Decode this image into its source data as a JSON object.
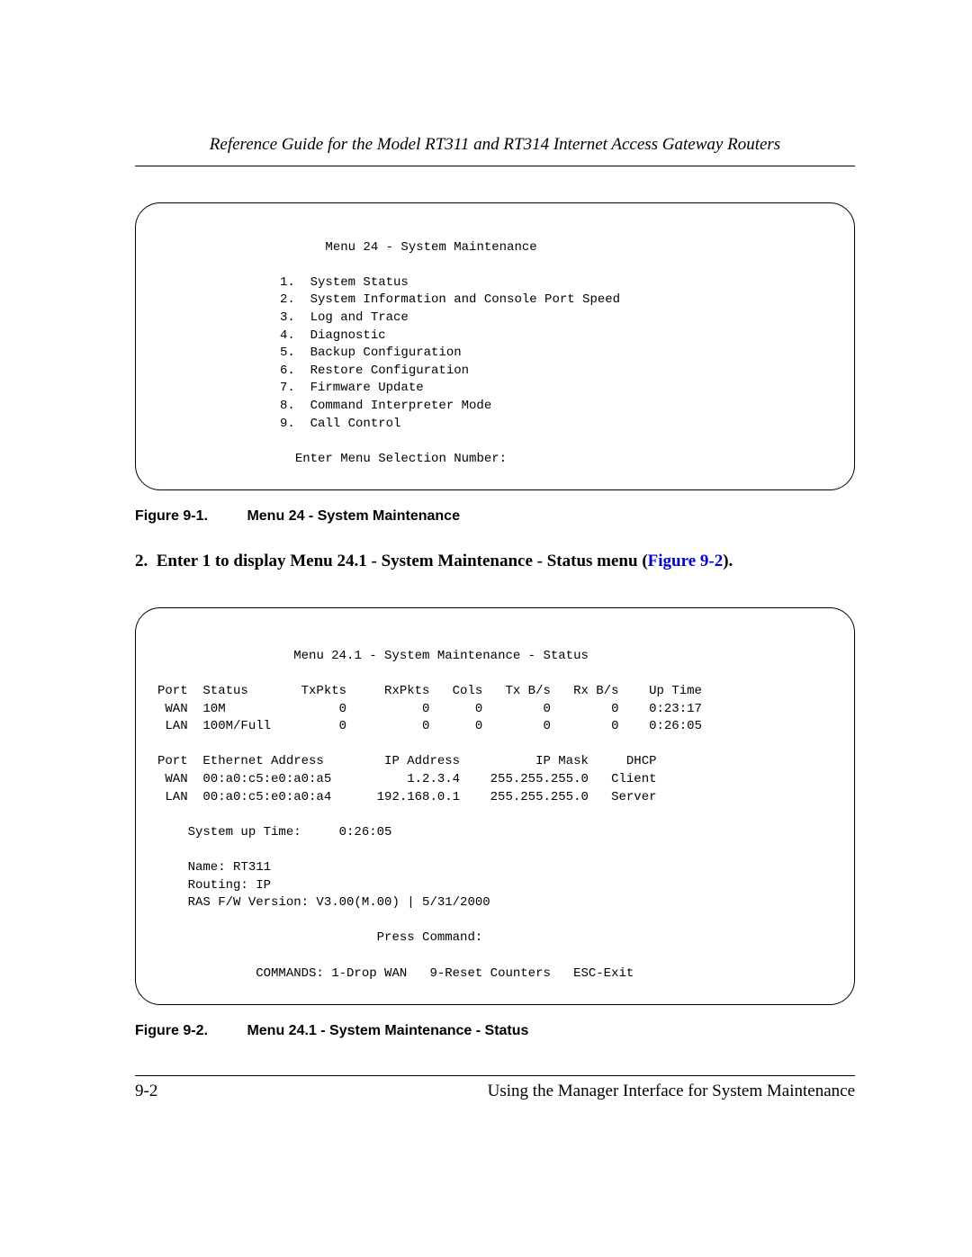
{
  "header": {
    "title": "Reference Guide for the Model RT311 and RT314 Internet Access Gateway Routers"
  },
  "box1": {
    "title": "Menu 24 - System Maintenance",
    "items": [
      "1.  System Status",
      "2.  System Information and Console Port Speed",
      "3.  Log and Trace",
      "4.  Diagnostic",
      "5.  Backup Configuration",
      "6.  Restore Configuration",
      "7.  Firmware Update",
      "8.  Command Interpreter Mode",
      "9.  Call Control"
    ],
    "prompt": "Enter Menu Selection Number:"
  },
  "caption1": {
    "fig": "Figure 9-1.",
    "text": "Menu 24 - System Maintenance"
  },
  "step2": {
    "num": "2.",
    "text_a": "Enter 1 to display Menu 24.1 - System Maintenance - Status menu (",
    "link": "Figure 9-2",
    "text_b": ")."
  },
  "box2": {
    "title": "Menu 24.1 - System Maintenance - Status",
    "hdr1": "Port  Status       TxPkts     RxPkts   Cols   Tx B/s   Rx B/s    Up Time",
    "row_wan1": " WAN  10M               0          0      0        0        0    0:23:17",
    "row_lan1": " LAN  100M/Full         0          0      0        0        0    0:26:05",
    "hdr2": "Port  Ethernet Address        IP Address          IP Mask     DHCP",
    "row_wan2": " WAN  00:a0:c5:e0:a0:a5          1.2.3.4    255.255.255.0   Client",
    "row_lan2": " LAN  00:a0:c5:e0:a0:a4      192.168.0.1    255.255.255.0   Server",
    "uptime": "    System up Time:     0:26:05",
    "name": "    Name: RT311",
    "routing": "    Routing: IP",
    "ras": "    RAS F/W Version: V3.00(M.00) | 5/31/2000",
    "press": "Press Command:",
    "commands": "COMMANDS: 1-Drop WAN   9-Reset Counters   ESC-Exit"
  },
  "caption2": {
    "fig": "Figure 9-2.",
    "text": "Menu 24.1 - System Maintenance - Status"
  },
  "footer": {
    "page": "9-2",
    "chapter": "Using the Manager Interface for System Maintenance"
  }
}
